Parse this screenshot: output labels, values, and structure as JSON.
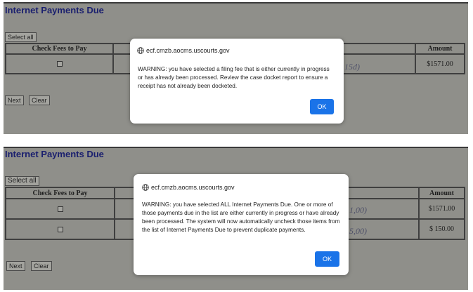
{
  "panel_top": {
    "title": "Internet Payments Due",
    "select_all_label": "Select all",
    "columns": {
      "fees": "Check Fees to Pay",
      "amount": "Amount"
    },
    "rows": [
      {
        "amount": "$1571.00",
        "smudge": "15d)"
      }
    ],
    "next_label": "Next",
    "clear_label": "Clear",
    "dialog": {
      "origin": "ecf.cmzb.aocms.uscourts.gov",
      "message": "WARNING: you have selected a filing fee that is either currently in progress or has already been processed.  Review the case docket report to ensure a receipt has not already been docketed.",
      "ok_label": "OK"
    }
  },
  "panel_bottom": {
    "title": "Internet Payments Due",
    "select_all_label": "Select all",
    "columns": {
      "fees": "Check Fees to Pay",
      "amount": "Amount"
    },
    "rows": [
      {
        "amount": "$1571.00",
        "smudge": "1,00)"
      },
      {
        "amount": "$ 150.00",
        "smudge": "5,00)"
      }
    ],
    "next_label": "Next",
    "clear_label": "Clear",
    "dialog": {
      "origin": "ecf.cmzb.aocms.uscourts.gov",
      "message": "WARNING: you have selected ALL Internet Payments Due. One or more of those payments due in the list are either currently in progress or have already been processed.  The system will now automatically uncheck those items from the list of Internet Payments Due to prevent duplicate payments.",
      "ok_label": "OK"
    }
  },
  "colors": {
    "accent": "#1a73e8",
    "title": "#1a1f6e",
    "backdrop": "#8f8f8a"
  }
}
